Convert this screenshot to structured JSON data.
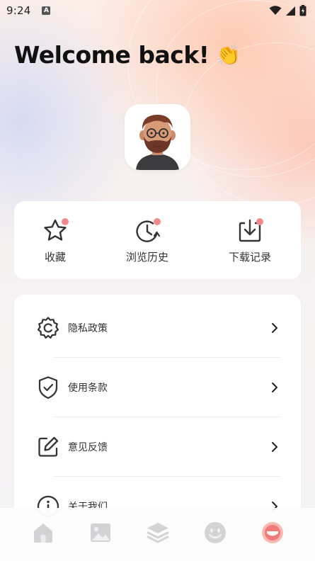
{
  "status": {
    "time": "9:24",
    "notif_badge": "A"
  },
  "header": {
    "title": "Welcome back!",
    "emoji": "👏"
  },
  "quick_actions": [
    {
      "label": "收藏",
      "icon": "star-icon"
    },
    {
      "label": "浏览历史",
      "icon": "history-icon"
    },
    {
      "label": "下载记录",
      "icon": "download-icon"
    }
  ],
  "menu": [
    {
      "label": "隐私政策",
      "icon": "gear-icon"
    },
    {
      "label": "使用条款",
      "icon": "shield-check-icon"
    },
    {
      "label": "意见反馈",
      "icon": "edit-icon"
    },
    {
      "label": "关于我们",
      "icon": "info-icon"
    }
  ],
  "tabs": [
    {
      "icon": "home-icon",
      "active": false
    },
    {
      "icon": "image-icon",
      "active": false
    },
    {
      "icon": "layers-icon",
      "active": false
    },
    {
      "icon": "smiley-icon",
      "active": false
    },
    {
      "icon": "profile-icon",
      "active": true
    }
  ],
  "colors": {
    "accent": "#f27979",
    "badge": "#f08a8a",
    "text": "#333333",
    "tab_inactive": "#c9c9cc"
  }
}
